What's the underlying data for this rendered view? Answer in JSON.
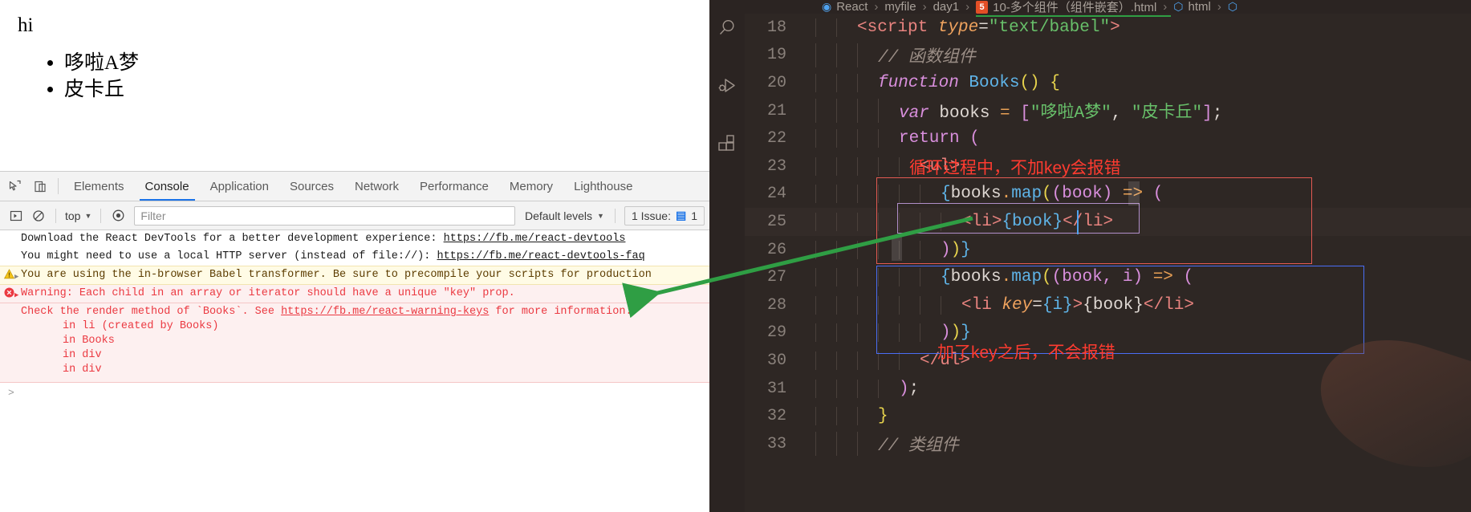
{
  "browser": {
    "page": {
      "heading": "hi",
      "list_items": [
        "哆啦A梦",
        "皮卡丘"
      ]
    }
  },
  "devtools": {
    "icons": {
      "inspect": "inspect-element-icon",
      "device": "device-toolbar-icon",
      "execute": "execute-snippet-icon",
      "clear": "clear-console-icon",
      "eye": "live-expression-icon"
    },
    "tabs": [
      {
        "label": "Elements",
        "active": false
      },
      {
        "label": "Console",
        "active": true
      },
      {
        "label": "Application",
        "active": false
      },
      {
        "label": "Sources",
        "active": false
      },
      {
        "label": "Network",
        "active": false
      },
      {
        "label": "Performance",
        "active": false
      },
      {
        "label": "Memory",
        "active": false
      },
      {
        "label": "Lighthouse",
        "active": false
      }
    ],
    "filterbar": {
      "context": "top",
      "filter_placeholder": "Filter",
      "filter_value": "",
      "levels": "Default levels",
      "issues_label": "1 Issue:",
      "issues_count": "1"
    },
    "messages": [
      {
        "type": "plain",
        "text": "Download the React DevTools for a better development experience: ",
        "link": "https://fb.me/react-devtools"
      },
      {
        "type": "plain",
        "text": "You might need to use a local HTTP server (instead of file://): ",
        "link": "https://fb.me/react-devtools-faq"
      },
      {
        "type": "warn",
        "text": "You are using the in-browser Babel transformer. Be sure to precompile your scripts for production"
      },
      {
        "type": "error",
        "text": "Warning: Each child in an array or iterator should have a unique \"key\" prop."
      }
    ],
    "error_detail": {
      "line_pre": "Check the render method of `Books`. See ",
      "link": "https://fb.me/react-warning-keys",
      "line_post": " for more information.",
      "stack": [
        "in li (created by Books)",
        "in Books",
        "in div",
        "in div"
      ]
    },
    "prompt": ">"
  },
  "vscode": {
    "activity_icons": [
      "search-icon",
      "run-and-debug-icon",
      "extensions-icon"
    ],
    "breadcrumb": {
      "items": [
        "React",
        "myfile",
        "day1"
      ],
      "file_badge": "5",
      "file": "10-多个组件（组件嵌套）.html",
      "tag1": "html",
      "tag2": ""
    },
    "code_lines": [
      {
        "no": "18",
        "tokens": [
          {
            "t": "<script ",
            "c": "t-tag"
          },
          {
            "t": "type",
            "c": "t-attr"
          },
          {
            "t": "=",
            "c": "t-punc"
          },
          {
            "t": "\"text/babel\"",
            "c": "t-str"
          },
          {
            "t": ">",
            "c": "t-tag"
          }
        ],
        "indent": "    "
      },
      {
        "no": "19",
        "tokens": [
          {
            "t": "// 函数组件",
            "c": "t-comment"
          }
        ],
        "indent": "      "
      },
      {
        "no": "20",
        "tokens": [
          {
            "t": "function ",
            "c": "t-kw"
          },
          {
            "t": "Books",
            "c": "t-fn"
          },
          {
            "t": "()",
            "c": "t-brace-y"
          },
          {
            "t": " ",
            "c": "t-plain"
          },
          {
            "t": "{",
            "c": "t-brace-y"
          }
        ],
        "indent": "      "
      },
      {
        "no": "21",
        "tokens": [
          {
            "t": "var ",
            "c": "t-kw"
          },
          {
            "t": "books ",
            "c": "t-plain"
          },
          {
            "t": "= ",
            "c": "t-op"
          },
          {
            "t": "[",
            "c": "t-bracket-m"
          },
          {
            "t": "\"哆啦A梦\"",
            "c": "t-str"
          },
          {
            "t": ", ",
            "c": "t-plain"
          },
          {
            "t": "\"皮卡丘\"",
            "c": "t-str"
          },
          {
            "t": "]",
            "c": "t-bracket-m"
          },
          {
            "t": ";",
            "c": "t-plain"
          }
        ],
        "indent": "        "
      },
      {
        "no": "22",
        "tokens": [
          {
            "t": "return ",
            "c": "t-kw2"
          },
          {
            "t": "(",
            "c": "t-brace-p"
          }
        ],
        "indent": "        "
      },
      {
        "no": "23",
        "tokens": [
          {
            "t": "<ul>",
            "c": "t-tag"
          }
        ],
        "indent": "          "
      },
      {
        "no": "24",
        "tokens": [
          {
            "t": "{",
            "c": "t-brace-b"
          },
          {
            "t": "books",
            "c": "t-plain"
          },
          {
            "t": ".",
            "c": "t-op"
          },
          {
            "t": "map",
            "c": "t-fn"
          },
          {
            "t": "(",
            "c": "t-brace-y"
          },
          {
            "t": "(book)",
            "c": "t-brace-p"
          },
          {
            "t": " ",
            "c": "t-plain"
          },
          {
            "t": "=>",
            "c": "t-op"
          },
          {
            "t": " ",
            "c": "t-plain"
          },
          {
            "t": "(",
            "c": "t-brace-p"
          }
        ],
        "indent": "            "
      },
      {
        "no": "25",
        "current": true,
        "tokens": [
          {
            "t": "<",
            "c": "t-tag"
          },
          {
            "t": "li",
            "c": "t-tag"
          },
          {
            "t": ">",
            "c": "t-tag"
          },
          {
            "t": "{book}",
            "c": "t-brace-b"
          },
          {
            "t": "</",
            "c": "t-tag"
          },
          {
            "t": "li",
            "c": "t-tag"
          },
          {
            "t": ">",
            "c": "t-tag"
          }
        ],
        "indent": "              "
      },
      {
        "no": "26",
        "tokens": [
          {
            "t": ")",
            "c": "t-brace-p"
          },
          {
            "t": ")",
            "c": "t-brace-y"
          },
          {
            "t": "}",
            "c": "t-brace-b"
          }
        ],
        "indent": "            "
      },
      {
        "no": "27",
        "tokens": [
          {
            "t": "{",
            "c": "t-brace-b"
          },
          {
            "t": "books",
            "c": "t-plain"
          },
          {
            "t": ".",
            "c": "t-op"
          },
          {
            "t": "map",
            "c": "t-fn"
          },
          {
            "t": "(",
            "c": "t-brace-y"
          },
          {
            "t": "(book, i)",
            "c": "t-brace-p"
          },
          {
            "t": " ",
            "c": "t-plain"
          },
          {
            "t": "=>",
            "c": "t-op"
          },
          {
            "t": " ",
            "c": "t-plain"
          },
          {
            "t": "(",
            "c": "t-brace-p"
          }
        ],
        "indent": "            "
      },
      {
        "no": "28",
        "tokens": [
          {
            "t": "<",
            "c": "t-tag"
          },
          {
            "t": "li ",
            "c": "t-tag"
          },
          {
            "t": "key",
            "c": "t-attr"
          },
          {
            "t": "=",
            "c": "t-punc"
          },
          {
            "t": "{i}",
            "c": "t-brace-b"
          },
          {
            "t": ">",
            "c": "t-tag"
          },
          {
            "t": "{book}",
            "c": "t-plain"
          },
          {
            "t": "</",
            "c": "t-tag"
          },
          {
            "t": "li",
            "c": "t-tag"
          },
          {
            "t": ">",
            "c": "t-tag"
          }
        ],
        "indent": "              "
      },
      {
        "no": "29",
        "tokens": [
          {
            "t": ")",
            "c": "t-brace-p"
          },
          {
            "t": ")",
            "c": "t-brace-y"
          },
          {
            "t": "}",
            "c": "t-brace-b"
          }
        ],
        "indent": "            "
      },
      {
        "no": "30",
        "tokens": [
          {
            "t": "</ul>",
            "c": "t-tag"
          }
        ],
        "indent": "          "
      },
      {
        "no": "31",
        "tokens": [
          {
            "t": ")",
            "c": "t-brace-p"
          },
          {
            "t": ";",
            "c": "t-plain"
          }
        ],
        "indent": "        "
      },
      {
        "no": "32",
        "tokens": [
          {
            "t": "}",
            "c": "t-brace-y"
          }
        ],
        "indent": "      "
      },
      {
        "no": "33",
        "tokens": [
          {
            "t": "// 类组件",
            "c": "t-comment"
          }
        ],
        "indent": "      "
      }
    ],
    "annotations": {
      "no_key_error": "循环过程中，不加key会报错",
      "with_key_ok": "加了key之后，不会报错"
    },
    "colors": {
      "editor_bg": "#2e2724",
      "red_box": "#e45a52",
      "blue_box": "#4a6ef5",
      "purple_box": "#b08ec9",
      "annotation_red": "#ff3b30",
      "arrow_green": "#2f9e44"
    }
  }
}
